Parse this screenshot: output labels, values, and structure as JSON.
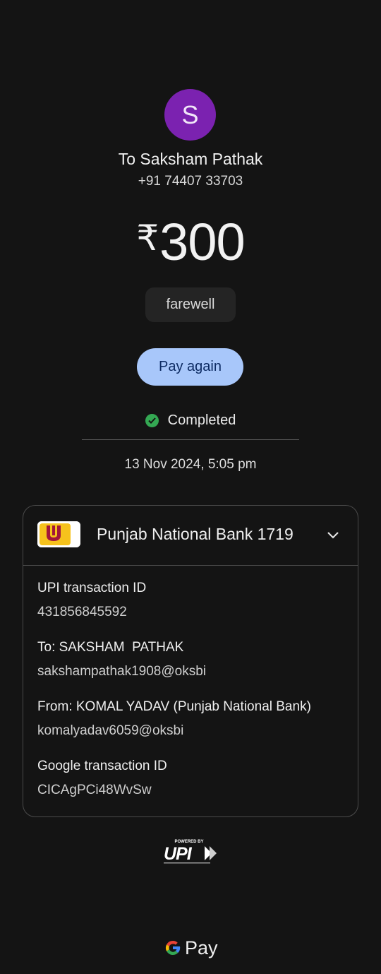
{
  "recipient": {
    "initial": "S",
    "name": "To Saksham Pathak",
    "phone": "+91 74407 33703"
  },
  "amount": {
    "currency": "₹",
    "value": "300"
  },
  "note": "farewell",
  "pay_again_label": "Pay again",
  "status": {
    "label": "Completed",
    "color": "#34a853"
  },
  "datetime": "13 Nov 2024, 5:05 pm",
  "bank": {
    "name": "Punjab National Bank 1719"
  },
  "details": [
    {
      "label": "UPI transaction ID",
      "value": "431856845592"
    },
    {
      "label": "To: SAKSHAM  PATHAK",
      "value": "sakshampathak1908@oksbi"
    },
    {
      "label": "From: KOMAL YADAV (Punjab National Bank)",
      "value": "komalyadav6059@oksbi"
    },
    {
      "label": "Google transaction ID",
      "value": "CICAgPCi48WvSw"
    }
  ],
  "upi": {
    "powered_by": "POWERED BY",
    "brand": "UPI"
  },
  "footer": {
    "g": "G",
    "pay": "Pay"
  },
  "colors": {
    "background": "#141414",
    "avatar": "#7b22b0",
    "pay_button": "#a8c7fa"
  }
}
